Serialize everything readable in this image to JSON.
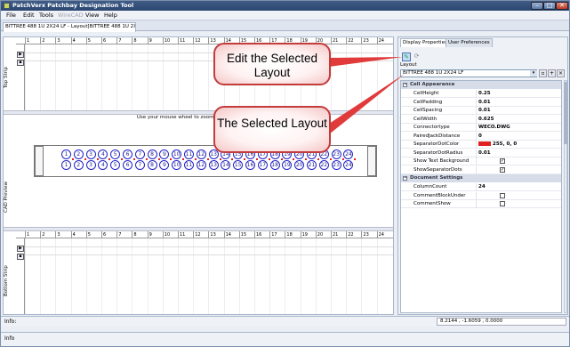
{
  "window": {
    "title": "PatchVerx Patchbay Designation Tool"
  },
  "menu": [
    "File",
    "Edit",
    "Tools",
    "WireCAD",
    "View",
    "Help"
  ],
  "doc_tab": "BITTREE 488 1U 2X24 LF - Layout[BITTREE 488 1U 2X24 LF]",
  "ruler_ticks": [
    "1",
    "2",
    "3",
    "4",
    "5",
    "6",
    "7",
    "8",
    "9",
    "10",
    "11",
    "12",
    "13",
    "14",
    "15",
    "16",
    "17",
    "18",
    "19",
    "20",
    "21",
    "22",
    "23",
    "24"
  ],
  "strips": {
    "top": "Top Strip",
    "cad": "CAD Preview",
    "bottom": "Bottom Strip"
  },
  "cad_hint": "Use your mouse wheel to zoom and pan this view.",
  "patchbay_numbers": [
    "1",
    "2",
    "3",
    "4",
    "5",
    "6",
    "7",
    "8",
    "9",
    "10",
    "11",
    "12",
    "13",
    "14",
    "15",
    "16",
    "17",
    "18",
    "19",
    "20",
    "21",
    "22",
    "23",
    "24"
  ],
  "panel": {
    "tabs": [
      "Display Properties",
      "User Preferences"
    ],
    "layout_label": "Layout",
    "layout_value": "BITTREE 488 1U 2X24 LF",
    "categories": [
      {
        "name": "Cell Appearance",
        "rows": [
          {
            "name": "CellHeight",
            "value": "0.25"
          },
          {
            "name": "CellPadding",
            "value": "0.01"
          },
          {
            "name": "CellSpacing",
            "value": "0.01"
          },
          {
            "name": "CellWidth",
            "value": "0.625"
          },
          {
            "name": "Connectortype",
            "value": "WECO.DWG"
          },
          {
            "name": "PairedJackDistance",
            "value": "0"
          },
          {
            "name": "SeparatorDotColor",
            "value": "255, 0, 0",
            "swatch": "#e02020"
          },
          {
            "name": "SeparatorDotRadius",
            "value": "0.01"
          },
          {
            "name": "Show Text Background",
            "check": true
          },
          {
            "name": "ShowSeparatorDots",
            "check": true
          }
        ]
      },
      {
        "name": "Document Settings",
        "rows": [
          {
            "name": "ColumnCount",
            "value": "24"
          },
          {
            "name": "CommentBlockUnder",
            "check": false
          },
          {
            "name": "CommentShow",
            "check": false
          }
        ]
      }
    ]
  },
  "info_label_1": "Info:",
  "coordinates": "8.2144 , -1.6059 , 0.0000",
  "info_label_2": "Info",
  "callouts": {
    "edit": "Edit the Selected Layout",
    "selected": "The Selected Layout"
  },
  "colors": {
    "callout_border": "#c43b3b",
    "callout_arrow": "#e03a3a",
    "separator_dot": "#e02020"
  }
}
